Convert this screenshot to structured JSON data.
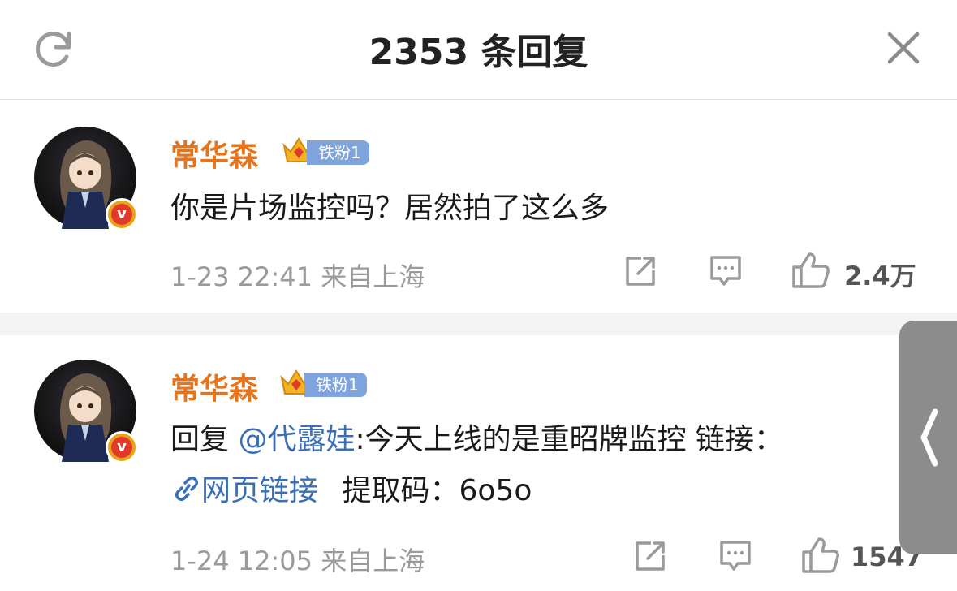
{
  "header": {
    "title": "2353 条回复",
    "refresh_icon": "refresh-icon",
    "close_icon": "close-icon"
  },
  "comments": [
    {
      "username": "常华森",
      "fan_badge": "铁粉1",
      "text": "你是片场监控吗？居然拍了这么多",
      "timestamp": "1-23 22:41",
      "location": "来自上海",
      "like_count": "2.4万"
    },
    {
      "username": "常华森",
      "fan_badge": "铁粉1",
      "reply_prefix": "回复",
      "mention": "@代露娃",
      "text": ":今天上线的是重昭牌监控 链接：",
      "link_label": "网页链接",
      "code_text": "提取码：",
      "code_value": "6o5o",
      "timestamp": "1-24 12:05",
      "location": "来自上海",
      "like_count": "1547"
    }
  ],
  "colors": {
    "username": "#e5741c",
    "link": "#3a6fb5",
    "badge": "#7fa4dd"
  }
}
